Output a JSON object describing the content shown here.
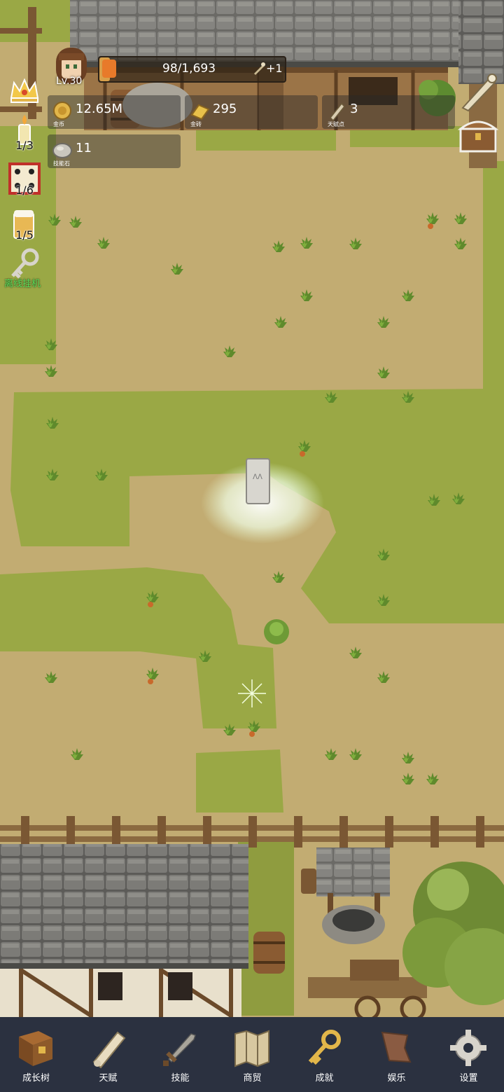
{
  "player": {
    "level": "Lv.30"
  },
  "xp_bar": {
    "value": "98/1,693",
    "bonus": "+1",
    "progress": 0.058
  },
  "resources": {
    "gold": {
      "value": "12.65M",
      "label": "金币"
    },
    "gold_brick": {
      "value": "295",
      "label": "金砖"
    },
    "talent_points": {
      "value": "3",
      "label": "天赋点"
    },
    "skill_stone": {
      "value": "11",
      "label": "技能石"
    }
  },
  "side_buttons": {
    "candle_count": "1/3",
    "dice_count": "1/6",
    "drink_count": "1/5",
    "offline_label": "离线挂机"
  },
  "bottom_nav": [
    {
      "label": "成长树",
      "icon": "book-icon"
    },
    {
      "label": "天赋",
      "icon": "scroll-icon"
    },
    {
      "label": "技能",
      "icon": "sword-icon"
    },
    {
      "label": "商贸",
      "icon": "map-icon"
    },
    {
      "label": "成就",
      "icon": "key-icon"
    },
    {
      "label": "娱乐",
      "icon": "flag-icon"
    },
    {
      "label": "设置",
      "icon": "gear-icon"
    }
  ],
  "colors": {
    "nav_bg": "#2b3140",
    "grass": "#9aa845",
    "dirt": "#c2ac72",
    "offline_text": "#5be05b"
  }
}
